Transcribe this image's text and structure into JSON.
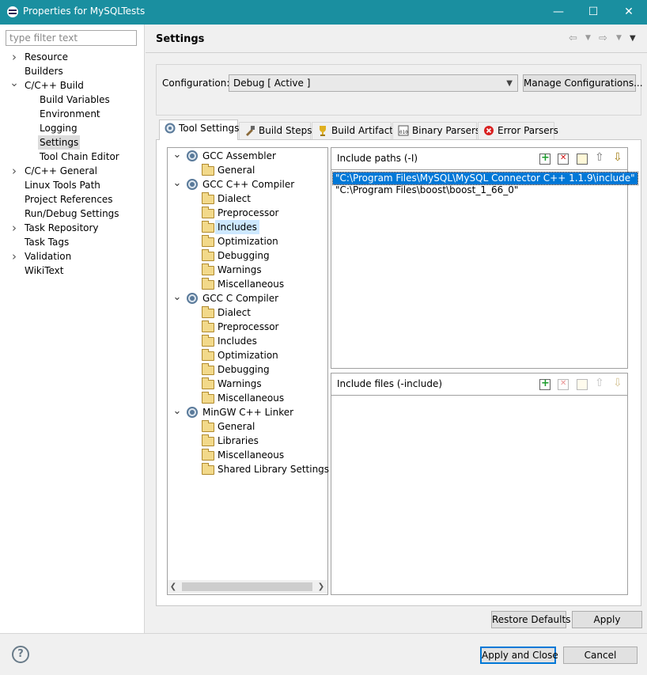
{
  "window": {
    "title": "Properties for MySQLTests",
    "minimize_glyph": "—",
    "maximize_glyph": "☐",
    "close_glyph": "✕"
  },
  "sidebar": {
    "filter_placeholder": "type filter text",
    "items": [
      {
        "label": "Resource",
        "level": 0,
        "expander": "collapsed"
      },
      {
        "label": "Builders",
        "level": 0,
        "expander": "none"
      },
      {
        "label": "C/C++ Build",
        "level": 0,
        "expander": "expanded"
      },
      {
        "label": "Build Variables",
        "level": 1,
        "expander": "none"
      },
      {
        "label": "Environment",
        "level": 1,
        "expander": "none"
      },
      {
        "label": "Logging",
        "level": 1,
        "expander": "none"
      },
      {
        "label": "Settings",
        "level": 1,
        "expander": "none",
        "selected": true
      },
      {
        "label": "Tool Chain Editor",
        "level": 1,
        "expander": "none"
      },
      {
        "label": "C/C++ General",
        "level": 0,
        "expander": "collapsed"
      },
      {
        "label": "Linux Tools Path",
        "level": 0,
        "expander": "none"
      },
      {
        "label": "Project References",
        "level": 0,
        "expander": "none"
      },
      {
        "label": "Run/Debug Settings",
        "level": 0,
        "expander": "none"
      },
      {
        "label": "Task Repository",
        "level": 0,
        "expander": "collapsed"
      },
      {
        "label": "Task Tags",
        "level": 0,
        "expander": "none"
      },
      {
        "label": "Validation",
        "level": 0,
        "expander": "collapsed"
      },
      {
        "label": "WikiText",
        "level": 0,
        "expander": "none"
      }
    ]
  },
  "header": {
    "title": "Settings",
    "back_icon": "back-arrow-icon",
    "forward_icon": "forward-arrow-icon",
    "menu_icon": "view-menu-icon"
  },
  "configuration": {
    "label": "Configuration:",
    "selected": "Debug  [ Active ]",
    "manage_button": "Manage Configurations..."
  },
  "tabs": [
    {
      "label": "Tool Settings",
      "icon": "tool-settings-icon",
      "active": true
    },
    {
      "label": "Build Steps",
      "icon": "build-steps-icon"
    },
    {
      "label": "Build Artifact",
      "icon": "build-artifact-icon"
    },
    {
      "label": "Binary Parsers",
      "icon": "binary-parsers-icon"
    },
    {
      "label": "Error Parsers",
      "icon": "error-parsers-icon"
    }
  ],
  "tool_tree": [
    {
      "label": "GCC Assembler",
      "type": "tool"
    },
    {
      "label": "General",
      "type": "option"
    },
    {
      "label": "GCC C++ Compiler",
      "type": "tool"
    },
    {
      "label": "Dialect",
      "type": "option"
    },
    {
      "label": "Preprocessor",
      "type": "option"
    },
    {
      "label": "Includes",
      "type": "option",
      "selected": true
    },
    {
      "label": "Optimization",
      "type": "option"
    },
    {
      "label": "Debugging",
      "type": "option"
    },
    {
      "label": "Warnings",
      "type": "option"
    },
    {
      "label": "Miscellaneous",
      "type": "option"
    },
    {
      "label": "GCC C Compiler",
      "type": "tool"
    },
    {
      "label": "Dialect",
      "type": "option"
    },
    {
      "label": "Preprocessor",
      "type": "option"
    },
    {
      "label": "Includes",
      "type": "option"
    },
    {
      "label": "Optimization",
      "type": "option"
    },
    {
      "label": "Debugging",
      "type": "option"
    },
    {
      "label": "Warnings",
      "type": "option"
    },
    {
      "label": "Miscellaneous",
      "type": "option"
    },
    {
      "label": "MinGW C++ Linker",
      "type": "tool"
    },
    {
      "label": "General",
      "type": "option"
    },
    {
      "label": "Libraries",
      "type": "option"
    },
    {
      "label": "Miscellaneous",
      "type": "option"
    },
    {
      "label": "Shared Library Settings",
      "type": "option"
    }
  ],
  "include_paths": {
    "title": "Include paths (-I)",
    "items": [
      "\"C:\\Program Files\\MySQL\\MySQL Connector C++ 1.1.9\\include\"",
      "\"C:\\Program Files\\boost\\boost_1_66_0\""
    ],
    "toolbar_icons": [
      "add-icon",
      "delete-icon",
      "edit-icon",
      "move-up-icon",
      "move-down-icon"
    ]
  },
  "include_files": {
    "title": "Include files (-include)",
    "items": [],
    "toolbar_icons": [
      "add-icon",
      "delete-icon",
      "edit-icon",
      "move-up-icon",
      "move-down-icon"
    ]
  },
  "buttons": {
    "restore_defaults": "Restore Defaults",
    "apply": "Apply",
    "apply_and_close": "Apply and Close",
    "cancel": "Cancel",
    "help": "?"
  },
  "colors": {
    "titlebar": "#1a8fa0",
    "selection": "#0078d7",
    "tree_selection": "#cde8ff"
  }
}
